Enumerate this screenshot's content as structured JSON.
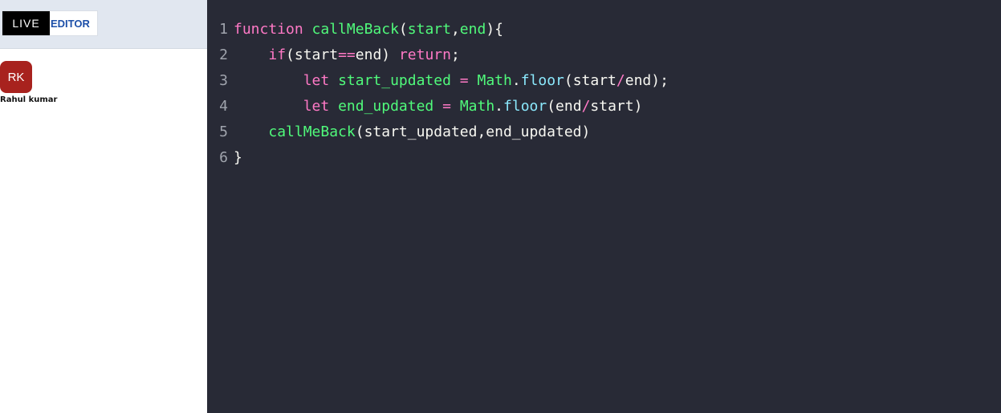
{
  "logo": {
    "live": "LIVE",
    "editor": "EDITOR"
  },
  "user": {
    "initials": "RK",
    "name": "Rahul kumar",
    "avatar_color": "#a8221e"
  },
  "editor": {
    "background": "#282a36",
    "lines": [
      {
        "number": "1",
        "tokens": [
          {
            "t": "function",
            "c": "kw"
          },
          {
            "t": " ",
            "c": "punc"
          },
          {
            "t": "callMeBack",
            "c": "fn"
          },
          {
            "t": "(",
            "c": "punc"
          },
          {
            "t": "start",
            "c": "param"
          },
          {
            "t": ",",
            "c": "punc"
          },
          {
            "t": "end",
            "c": "param"
          },
          {
            "t": "){",
            "c": "punc"
          }
        ]
      },
      {
        "number": "2",
        "tokens": [
          {
            "t": "    ",
            "c": "punc"
          },
          {
            "t": "if",
            "c": "kw"
          },
          {
            "t": "(start",
            "c": "punc"
          },
          {
            "t": "==",
            "c": "op"
          },
          {
            "t": "end) ",
            "c": "punc"
          },
          {
            "t": "return",
            "c": "kw"
          },
          {
            "t": ";",
            "c": "punc"
          }
        ]
      },
      {
        "number": "3",
        "tokens": [
          {
            "t": "        ",
            "c": "punc"
          },
          {
            "t": "let",
            "c": "kw"
          },
          {
            "t": " ",
            "c": "punc"
          },
          {
            "t": "start_updated",
            "c": "fn"
          },
          {
            "t": " ",
            "c": "punc"
          },
          {
            "t": "=",
            "c": "op"
          },
          {
            "t": " ",
            "c": "punc"
          },
          {
            "t": "Math",
            "c": "fn"
          },
          {
            "t": ".",
            "c": "punc"
          },
          {
            "t": "floor",
            "c": "prop"
          },
          {
            "t": "(start",
            "c": "punc"
          },
          {
            "t": "/",
            "c": "op"
          },
          {
            "t": "end);",
            "c": "punc"
          }
        ]
      },
      {
        "number": "4",
        "tokens": [
          {
            "t": "        ",
            "c": "punc"
          },
          {
            "t": "let",
            "c": "kw"
          },
          {
            "t": " ",
            "c": "punc"
          },
          {
            "t": "end_updated",
            "c": "fn"
          },
          {
            "t": " ",
            "c": "punc"
          },
          {
            "t": "=",
            "c": "op"
          },
          {
            "t": " ",
            "c": "punc"
          },
          {
            "t": "Math",
            "c": "fn"
          },
          {
            "t": ".",
            "c": "punc"
          },
          {
            "t": "floor",
            "c": "prop"
          },
          {
            "t": "(end",
            "c": "punc"
          },
          {
            "t": "/",
            "c": "op"
          },
          {
            "t": "start)",
            "c": "punc"
          }
        ]
      },
      {
        "number": "5",
        "tokens": [
          {
            "t": "    ",
            "c": "punc"
          },
          {
            "t": "callMeBack",
            "c": "fn"
          },
          {
            "t": "(start_updated,end_updated)",
            "c": "punc"
          }
        ]
      },
      {
        "number": "6",
        "tokens": [
          {
            "t": "}",
            "c": "punc"
          }
        ]
      }
    ]
  }
}
